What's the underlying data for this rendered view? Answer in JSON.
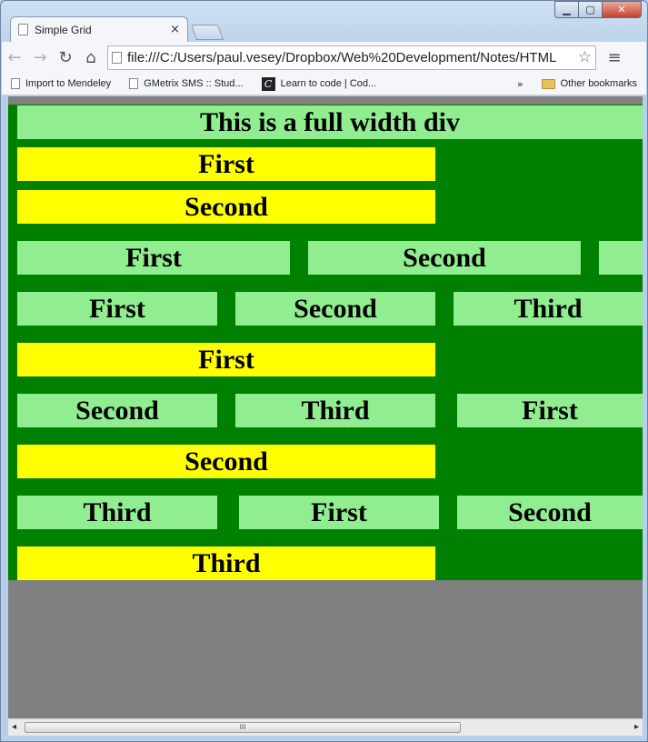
{
  "window": {
    "minimize_glyph": "▁",
    "maximize_glyph": "▢",
    "close_glyph": "✕"
  },
  "tab": {
    "title": "Simple Grid",
    "close_glyph": "×"
  },
  "toolbar": {
    "back_glyph": "←",
    "forward_glyph": "→",
    "reload_glyph": "↻",
    "home_glyph": "⌂",
    "url": "file:///C:/Users/paul.vesey/Dropbox/Web%20Development/Notes/HTML",
    "star_glyph": "☆",
    "menu_glyph": "≡"
  },
  "bookmarks": {
    "items": [
      "Import to Mendeley",
      "GMetrix SMS :: Stud...",
      "Learn to code | Cod..."
    ],
    "codecademy_glyph": "C",
    "more": "»",
    "other": "Other bookmarks"
  },
  "page": {
    "full_width": "This is a full width div",
    "row1": [
      "First",
      "Second"
    ],
    "row2": [
      "First",
      "Second"
    ],
    "row3": [
      "First",
      "Second",
      "Third"
    ],
    "row4": [
      "First"
    ],
    "row5": [
      "Second",
      "Third",
      "First"
    ],
    "row6": [
      "Second"
    ],
    "row7": [
      "Third",
      "First",
      "Second"
    ],
    "row8": [
      "Third"
    ]
  },
  "scrollbar": {
    "left_glyph": "◂",
    "right_glyph": "▸",
    "grip": "III"
  },
  "colors": {
    "page_bg": "#808080",
    "container": "#008000",
    "light_green": "#90ee90",
    "yellow": "#ffff00"
  }
}
